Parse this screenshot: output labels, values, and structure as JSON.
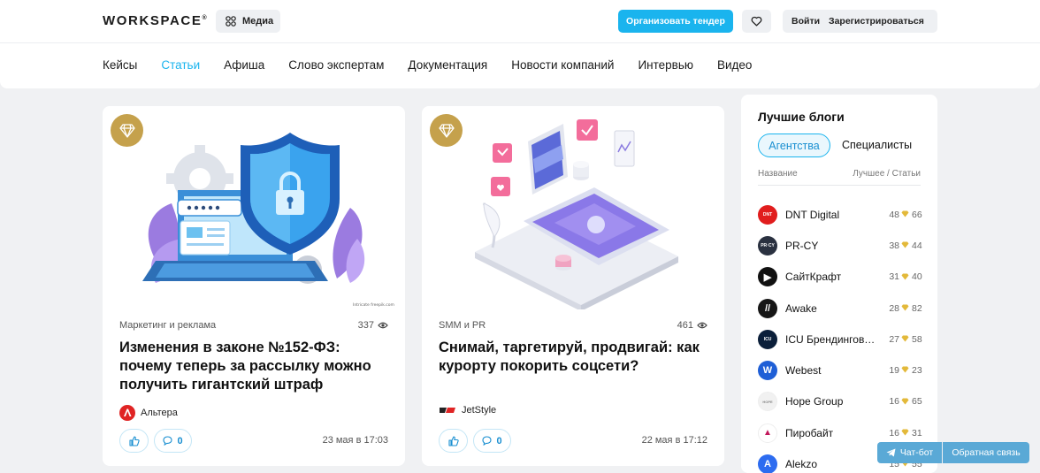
{
  "header": {
    "logo": "WORKSPACE",
    "logo_mark": "®",
    "media_label": "Медиа",
    "tender_label": "Организовать тендер",
    "login_label": "Войти",
    "register_label": "Зарегистрироваться"
  },
  "nav": [
    {
      "label": "Кейсы",
      "active": false
    },
    {
      "label": "Статьи",
      "active": true
    },
    {
      "label": "Афиша",
      "active": false
    },
    {
      "label": "Слово экспертам",
      "active": false
    },
    {
      "label": "Документация",
      "active": false
    },
    {
      "label": "Новости компаний",
      "active": false
    },
    {
      "label": "Интервью",
      "active": false
    },
    {
      "label": "Видео",
      "active": false
    }
  ],
  "colors": {
    "accent": "#1ab4ee",
    "badge_gold": "#c5a14c",
    "page_bg": "#f0f1f3"
  },
  "articles": [
    {
      "category": "Маркетинг и реклама",
      "views": "337",
      "title": "Изменения в законе №152-ФЗ: почему теперь за рассылку можно получить гигантский штраф",
      "author": "Альтера",
      "likes": "",
      "comments": "0",
      "date": "23 мая в 17:03",
      "illustration": "security-shield-laptop",
      "credit": "Intricate freepik.com"
    },
    {
      "category": "SMM и PR",
      "views": "461",
      "title": "Снимай, таргетируй, продвигай: как курорту покорить соцсети?",
      "author": "JetStyle",
      "likes": "",
      "comments": "0",
      "date": "22 мая в 17:12",
      "illustration": "isometric-smartphone-social"
    }
  ],
  "sidebar": {
    "title": "Лучшие блоги",
    "tab_active": "Агентства",
    "tab_inactive": "Специалисты",
    "col_name": "Название",
    "col_stats": "Лучшее / Статьи",
    "items": [
      {
        "name": "DNT Digital",
        "best": "48",
        "count": "66",
        "color": "#e11d1d",
        "mark": "DNT"
      },
      {
        "name": "PR-CY",
        "best": "38",
        "count": "44",
        "color": "#2a3140",
        "mark": "PR·CY"
      },
      {
        "name": "СайтКрафт",
        "best": "31",
        "count": "40",
        "color": "#111111",
        "mark": "▶"
      },
      {
        "name": "Awake",
        "best": "28",
        "count": "82",
        "color": "#161616",
        "mark": "//"
      },
      {
        "name": "ICU Брендинговое агентство",
        "best": "27",
        "count": "58",
        "color": "#0b1f3a",
        "mark": "ICU"
      },
      {
        "name": "Webest",
        "best": "19",
        "count": "23",
        "color": "#1f5fd6",
        "mark": "W"
      },
      {
        "name": "Hope Group",
        "best": "16",
        "count": "65",
        "color": "#f1f1f1",
        "mark": "HOPE"
      },
      {
        "name": "Пиробайт",
        "best": "16",
        "count": "31",
        "color": "#ffffff",
        "mark": "▲"
      },
      {
        "name": "Alekzo",
        "best": "15",
        "count": "55",
        "color": "#2d6cf0",
        "mark": "A"
      }
    ]
  },
  "floating": {
    "chat_label": "Чат-бот",
    "feedback_label": "Обратная связь"
  }
}
